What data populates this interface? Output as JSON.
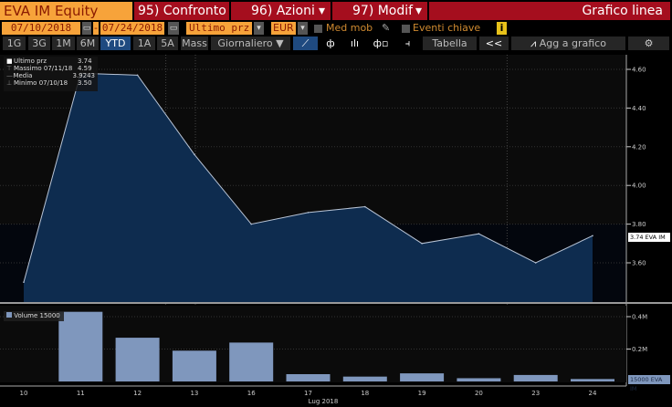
{
  "header": {
    "security": "EVA IM Equity",
    "buttons": [
      "95) Confronto",
      "96) Azioni",
      "97) Modif"
    ],
    "chart_type": "Grafico linea"
  },
  "controls": {
    "start_date": "07/10/2018",
    "dash": "-",
    "end_date": "07/24/2018",
    "field": "Ultimo prz",
    "currency": "EUR",
    "moving_avg": "Med mob",
    "key_events": "Eventi chiave",
    "info": "i"
  },
  "periods": [
    "1G",
    "3G",
    "1M",
    "6M",
    "YTD",
    "1A",
    "5A",
    "Mass"
  ],
  "selected_period": "YTD",
  "frequency": "Giornaliero ▼",
  "toolbar": {
    "table": "Tabella",
    "collapse": "<<",
    "add_to_chart": "Agg a grafico"
  },
  "legend": {
    "rows": [
      [
        "Ultimo prz",
        "3.74"
      ],
      [
        "Massimo 07/11/18",
        "4.59"
      ],
      [
        "Media",
        "3.9243"
      ],
      [
        "Minimo 07/10/18",
        "3.50"
      ]
    ],
    "volume": "Volume 15000"
  },
  "price_tag": "3.74 EVA IM",
  "volume_tag": "15000 EVA IM",
  "colors": {
    "orange": "#f7a33a",
    "red": "#a50e1e",
    "area": "#0e2c4f",
    "bar": "#7f97bd"
  },
  "chart_data": [
    {
      "type": "area",
      "title": "EVA IM Equity price",
      "x": [
        "10",
        "11",
        "12",
        "13",
        "16",
        "17",
        "18",
        "19",
        "20",
        "23",
        "24"
      ],
      "values": [
        3.5,
        4.58,
        4.57,
        4.16,
        3.8,
        3.86,
        3.89,
        3.7,
        3.75,
        3.6,
        3.74
      ],
      "ylim": [
        3.4,
        4.68
      ],
      "yticks": [
        "4.60",
        "4.40",
        "4.20",
        "4.00",
        "3.80",
        "3.60"
      ],
      "ytick_values": [
        4.6,
        4.4,
        4.2,
        4.0,
        3.8,
        3.6
      ],
      "xlabel": "Lug 2018"
    },
    {
      "type": "bar",
      "title": "Volume",
      "x": [
        "10",
        "11",
        "12",
        "13",
        "16",
        "17",
        "18",
        "19",
        "20",
        "23",
        "24"
      ],
      "values": [
        0,
        430000,
        270000,
        190000,
        240000,
        45000,
        30000,
        50000,
        20000,
        40000,
        15000
      ],
      "ylim": [
        0,
        460000
      ],
      "yticks": [
        "0.4M",
        "0.2M"
      ],
      "ytick_values": [
        400000,
        200000
      ]
    }
  ]
}
